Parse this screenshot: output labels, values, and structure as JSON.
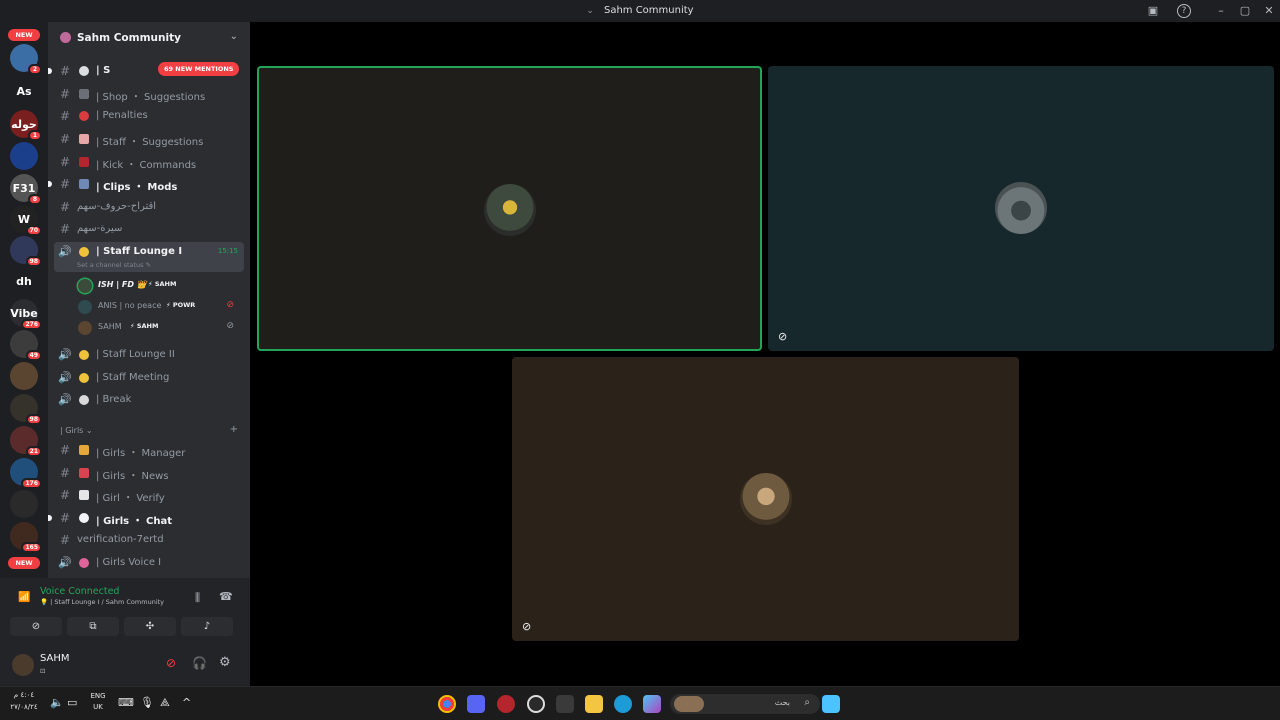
{
  "window": {
    "title": "Sahm Community"
  },
  "servers": [
    {
      "label": "",
      "color": "#3a6ea5",
      "badge": "2"
    },
    {
      "label": "As",
      "color": "#1e1f22",
      "badge": ""
    },
    {
      "label": "حوله",
      "color": "#7a1f1f",
      "badge": "1"
    },
    {
      "label": "",
      "color": "#1b3f8b",
      "badge": ""
    },
    {
      "label": "F31",
      "color": "#555",
      "badge": "8"
    },
    {
      "label": "W",
      "color": "#222",
      "badge": "70"
    },
    {
      "label": "",
      "color": "#30395a",
      "badge": "98"
    },
    {
      "label": "dh",
      "color": "#1e1f22",
      "badge": ""
    },
    {
      "label": "Vibe",
      "color": "#2b2d31",
      "badge": "276"
    },
    {
      "label": "",
      "color": "#3c3c3c",
      "badge": "49"
    },
    {
      "label": "",
      "color": "#5a4630",
      "badge": ""
    },
    {
      "label": "",
      "color": "#35312b",
      "badge": "98"
    },
    {
      "label": "",
      "color": "#5b2a2a",
      "badge": "21"
    },
    {
      "label": "",
      "color": "#1f4f7a",
      "badge": "176"
    },
    {
      "label": "",
      "color": "#2a2a2a",
      "badge": ""
    },
    {
      "label": "",
      "color": "#402a1f",
      "badge": "165"
    }
  ],
  "server_new_label": "NEW",
  "server": {
    "name": "Sahm Community"
  },
  "mentions_pill": "69 NEW MENTIONS",
  "channels": {
    "c0": "| S",
    "c1": "| Shop ・ Suggestions",
    "c2": "| Penalties",
    "c3": "| Staff ・ Suggestions",
    "c4": "| Kick ・ Commands",
    "c5": "| Clips ・ Mods",
    "c6": "اقتراح-حروف-سهم",
    "c7": "سيرة-سهم",
    "lounge1": "| Staff Lounge I",
    "lounge1_time": "15:15",
    "lounge1_status": "Set a channel status ✎",
    "lounge2": "| Staff Lounge II",
    "meeting": "| Staff Meeting",
    "break": "| Break",
    "girls_manager": "| Girls ・ Manager",
    "girls_news": "| Girls ・ News",
    "girl_verify": "| Girl ・ Verify",
    "girls_chat": "| Girls ・ Chat",
    "verification": "verification-7ertd",
    "girls_voice": "| Girls Voice I"
  },
  "category_girls": "| Girls ⌄",
  "voice_users": [
    {
      "name": "ISH | FD 👑",
      "tag": "⚡ SAHM"
    },
    {
      "name": "ANIS | no peace",
      "tag": "⚡ POWR"
    },
    {
      "name": "SAHM",
      "tag": "⚡ SAHM"
    }
  ],
  "voice": {
    "status": "Voice Connected",
    "location": "💡 | Staff Lounge I / Sahm Community"
  },
  "user": {
    "name": "SAHM",
    "status": "⊡"
  },
  "taskbar": {
    "lang": "ENG",
    "region": "UK",
    "time": "٤:٠٤ م",
    "date": "٢٧/٠٨/٢٤",
    "search_placeholder": "بحث"
  },
  "colors": {
    "green": "#23a559",
    "red": "#f23f42",
    "sidebar": "#2b2d31",
    "tile1": "#1f1e1b",
    "tile2": "#16282c",
    "tile3": "#2b231a"
  }
}
